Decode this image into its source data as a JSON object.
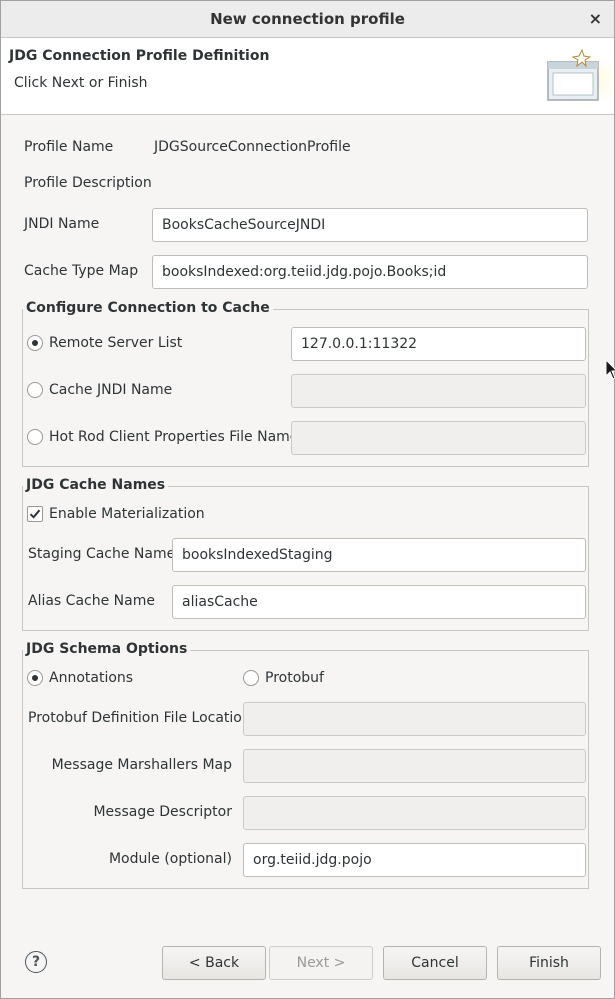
{
  "window": {
    "title": "New connection profile",
    "close_glyph": "×"
  },
  "banner": {
    "title": "JDG Connection Profile Definition",
    "subtitle": "Click Next or Finish"
  },
  "profile": {
    "name_label": "Profile Name",
    "name_value": "JDGSourceConnectionProfile",
    "description_label": "Profile Description",
    "jndi_label": "JNDI Name",
    "jndi_value": "BooksCacheSourceJNDI",
    "cache_type_label": "Cache Type Map",
    "cache_type_value": "booksIndexed:org.teiid.jdg.pojo.Books;id"
  },
  "connection": {
    "title": "Configure Connection to Cache",
    "remote_label": "Remote Server List",
    "remote_value": "127.0.0.1:11322",
    "jndi_label": "Cache JNDI Name",
    "jndi_value": "",
    "hotrod_label": "Hot Rod Client Properties File Name",
    "hotrod_value": "",
    "selected": "remote"
  },
  "cache_names": {
    "title": "JDG Cache Names",
    "materialization_label": "Enable Materialization",
    "materialization_checked": true,
    "staging_label": "Staging Cache Name",
    "staging_value": "booksIndexedStaging",
    "alias_label": "Alias Cache Name",
    "alias_value": "aliasCache"
  },
  "schema": {
    "title": "JDG Schema Options",
    "annotations_label": "Annotations",
    "protobuf_label": "Protobuf",
    "selected": "annotations",
    "protobuf_location_label": "Protobuf Definition File Location",
    "protobuf_location_value": "",
    "marshallers_label": "Message Marshallers Map",
    "marshallers_value": "",
    "descriptor_label": "Message Descriptor",
    "descriptor_value": "",
    "module_label": "Module (optional)",
    "module_value": "org.teiid.jdg.pojo"
  },
  "buttons": {
    "help": "?",
    "back": "< Back",
    "next": "Next >",
    "cancel": "Cancel",
    "finish": "Finish"
  }
}
